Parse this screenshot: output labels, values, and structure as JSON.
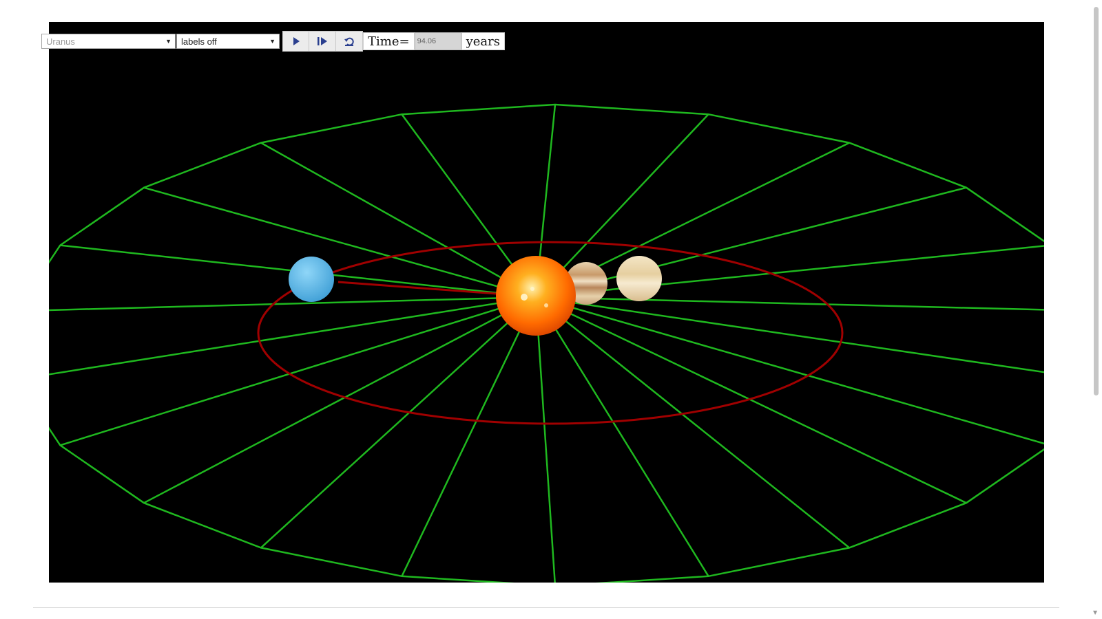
{
  "controls": {
    "planet_select": {
      "selected": "Uranus"
    },
    "labels_select": {
      "selected": "labels off"
    },
    "time_label": "Time=",
    "time_value": "94.06",
    "units_label": "years"
  },
  "icons": {
    "play": "play-icon",
    "step": "step-forward-icon",
    "reset": "reset-icon"
  },
  "scene": {
    "bodies": [
      "sun",
      "jupiter",
      "saturn",
      "uranus"
    ],
    "colors": {
      "background": "#000000",
      "grid": "#1fb81f",
      "orbit": "#a00000",
      "sun": "#ff7a00",
      "jupiter": "#d8b48a",
      "saturn": "#ecd9b0",
      "uranus": "#6cc4ee"
    }
  }
}
